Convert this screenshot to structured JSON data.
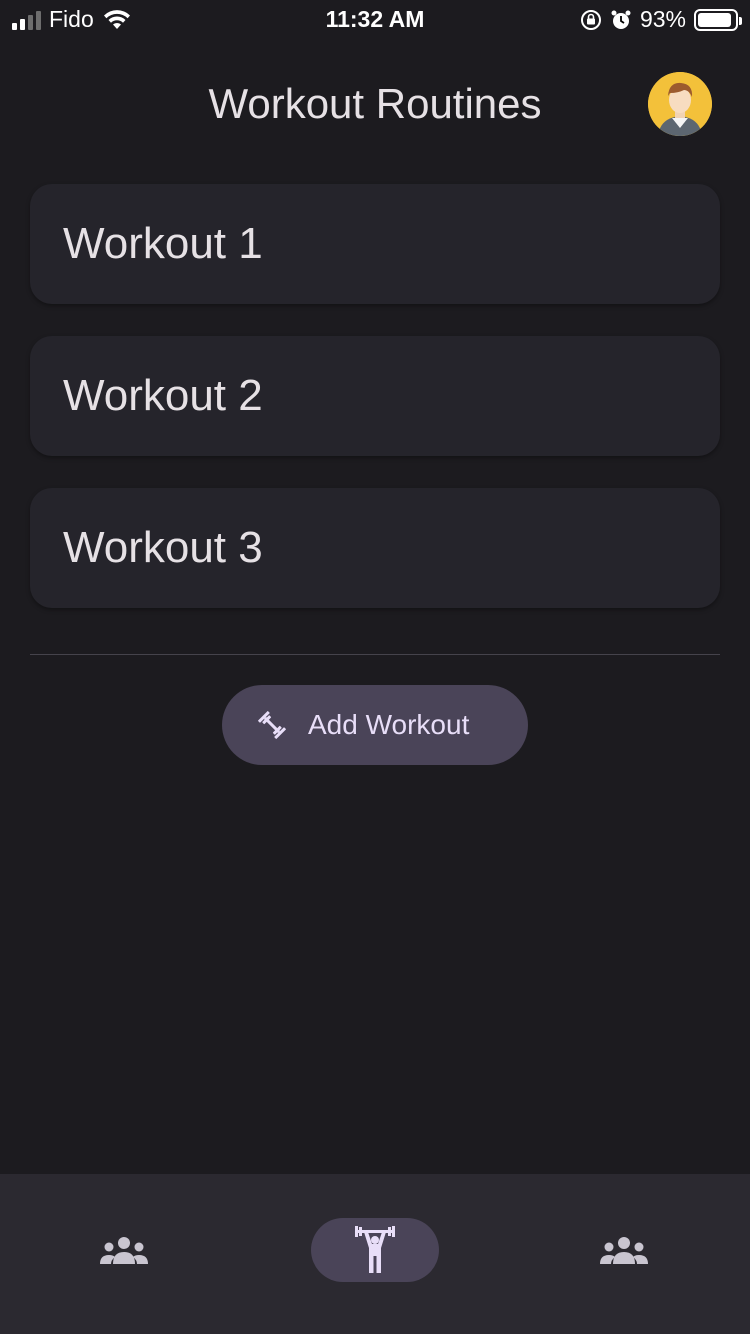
{
  "status_bar": {
    "carrier": "Fido",
    "time": "11:32 AM",
    "battery_percent": "93%",
    "battery_level": 0.93
  },
  "header": {
    "title": "Workout Routines",
    "avatar_icon": "user-avatar-icon"
  },
  "workouts": [
    {
      "label": "Workout 1"
    },
    {
      "label": "Workout 2"
    },
    {
      "label": "Workout 3"
    }
  ],
  "add_button": {
    "label": "Add Workout",
    "icon": "dumbbell-icon"
  },
  "bottom_nav": {
    "items": [
      {
        "icon": "group-icon",
        "selected": false
      },
      {
        "icon": "weightlifter-icon",
        "selected": true
      },
      {
        "icon": "group-icon",
        "selected": false
      }
    ]
  },
  "colors": {
    "background": "#1c1b1f",
    "card": "#25242b",
    "accent_container": "#4a4458",
    "nav_background": "#2b2930",
    "avatar_background": "#f3c13a"
  }
}
